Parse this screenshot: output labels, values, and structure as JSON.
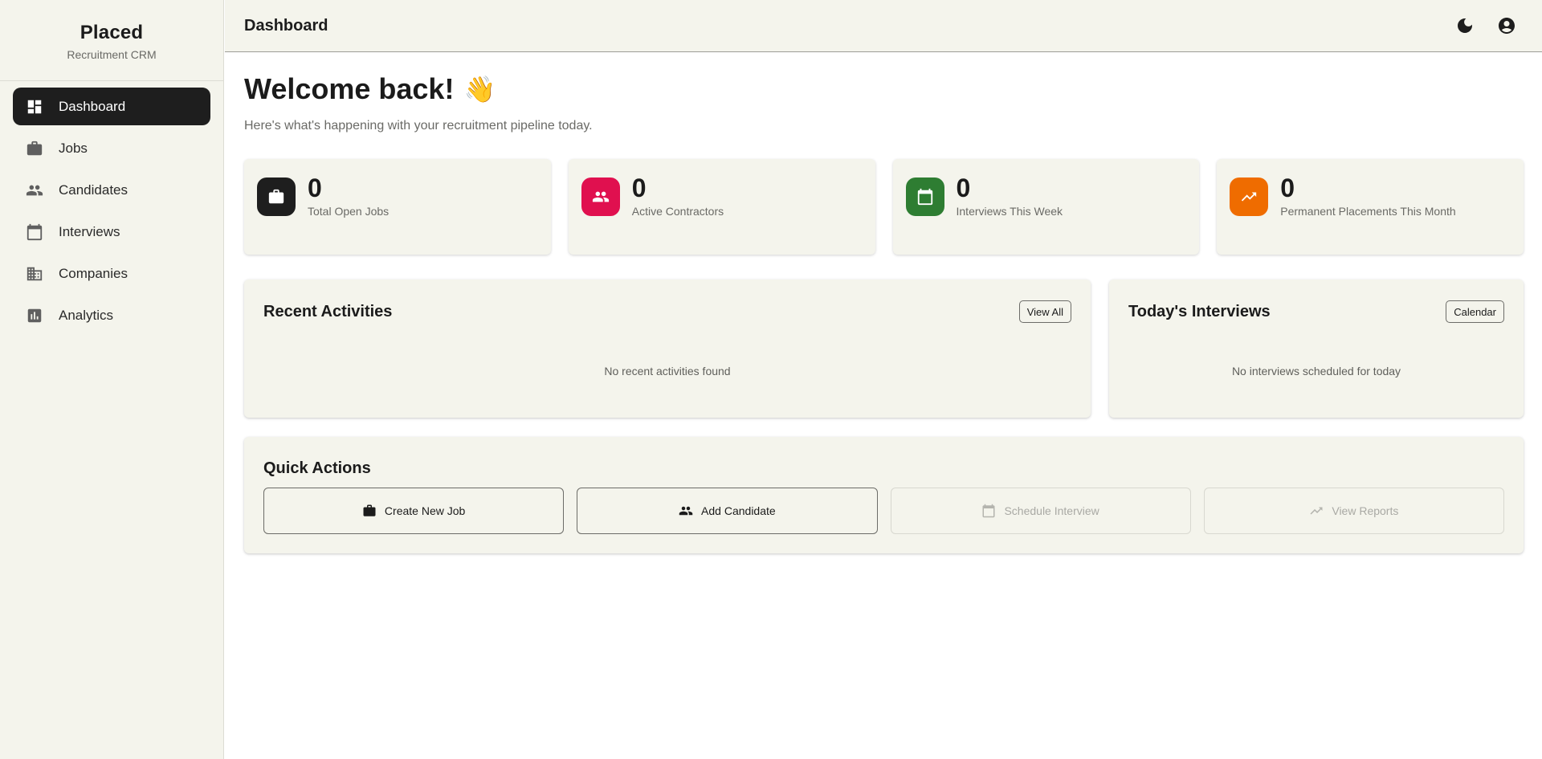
{
  "brand": {
    "name": "Placed",
    "subtitle": "Recruitment CRM"
  },
  "sidebar": {
    "items": [
      {
        "label": "Dashboard",
        "icon": "dashboard-icon",
        "active": true
      },
      {
        "label": "Jobs",
        "icon": "briefcase-icon",
        "active": false
      },
      {
        "label": "Candidates",
        "icon": "people-icon",
        "active": false
      },
      {
        "label": "Interviews",
        "icon": "calendar-icon",
        "active": false
      },
      {
        "label": "Companies",
        "icon": "building-icon",
        "active": false
      },
      {
        "label": "Analytics",
        "icon": "analytics-icon",
        "active": false
      }
    ]
  },
  "header": {
    "title": "Dashboard",
    "actions": [
      {
        "icon": "dark-mode-moon-icon"
      },
      {
        "icon": "account-circle-icon"
      }
    ]
  },
  "main": {
    "welcome": "Welcome back!",
    "wave_emoji": "👋",
    "subtitle": "Here's what's happening with your recruitment pipeline today.",
    "stats": [
      {
        "value": "0",
        "label": "Total Open Jobs",
        "icon": "briefcase-icon",
        "color": "#1e1e1e"
      },
      {
        "value": "0",
        "label": "Active Contractors",
        "icon": "people-icon",
        "color": "#e0104f"
      },
      {
        "value": "0",
        "label": "Interviews This Week",
        "icon": "calendar-icon",
        "color": "#2e7d32"
      },
      {
        "value": "0",
        "label": "Permanent Placements This Month",
        "icon": "trending-up-icon",
        "color": "#ef6c00"
      }
    ],
    "recent_activities": {
      "title": "Recent Activities",
      "button": "View All",
      "empty": "No recent activities found"
    },
    "todays_interviews": {
      "title": "Today's Interviews",
      "button": "Calendar",
      "empty": "No interviews scheduled for today"
    },
    "quick_actions": {
      "title": "Quick Actions",
      "buttons": [
        {
          "label": "Create New Job",
          "icon": "briefcase-icon",
          "enabled": true
        },
        {
          "label": "Add Candidate",
          "icon": "people-icon",
          "enabled": true
        },
        {
          "label": "Schedule Interview",
          "icon": "calendar-icon",
          "enabled": false
        },
        {
          "label": "View Reports",
          "icon": "trending-up-icon",
          "enabled": false
        }
      ]
    }
  }
}
